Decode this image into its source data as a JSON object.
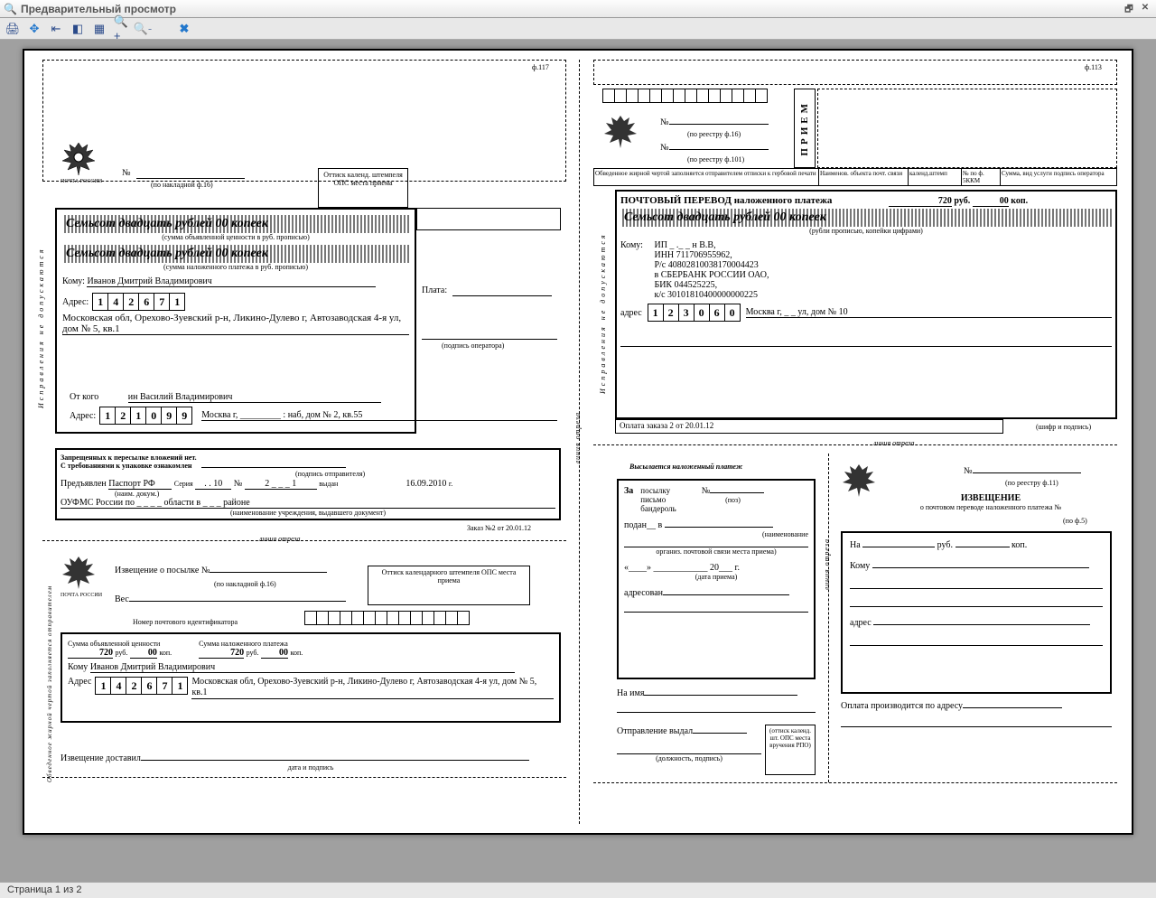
{
  "window": {
    "title": "Предварительный просмотр"
  },
  "status": {
    "page": "Страница 1 из 2"
  },
  "formNums": {
    "f117": "ф.117",
    "f113": "ф.113",
    "f101": "(по реестру ф.101)",
    "f16": "(по реестру ф.16)",
    "f16b": "(по накладной ф.16)",
    "f11": "(по реестру ф.11)",
    "f5": "(по ф.5)"
  },
  "nakl": {
    "no": "№",
    "sum_text": "Семьсот двадцать рублей 00 копеек",
    "sum_caption1": "(сумма объявленной ценности в руб. прописью)",
    "sum_caption2": "(сумма наложенного платежа в руб. прописью)",
    "komu": "Кому:",
    "komu_val": "Иванов Дмитрий Владимирович",
    "plata": "Плата:",
    "adres": "Адрес:",
    "idx": [
      "1",
      "4",
      "2",
      "6",
      "7",
      "1"
    ],
    "adres_val": "Московская обл, Орехово-Зуевский р-н, Ликино-Дулево г, Автозаводская 4-я ул, дом № 5, кв.1",
    "oper_sign": "(подпись оператора)",
    "otkogo": "От кого",
    "otkogo_val": "ин Василий Владимирович",
    "idx2": [
      "1",
      "2",
      "1",
      "0",
      "9",
      "9"
    ],
    "adres2_val": "Москва г, _________ : наб, дом № 2, кв.55",
    "zapret": "Запрещенных к пересылке вложений нет.",
    "treb": "С требованиями к упаковке ознакомлен",
    "otpr_sign": "(подпись отправителя)",
    "pred": "Предъявлен",
    "doc": "Паспорт РФ",
    "ser": "Серия",
    "ser_v": ". . 10",
    "no2": "№",
    "no2_v": "2 _ _ _ 1",
    "vydan": "выдан",
    "date": "16.09.2010",
    "g": "г.",
    "oufms": "ОУФМС России по _ _ _       _ области в _ _          _ районе",
    "doc_cap": "(наименование учреждения, выдавшего документ)",
    "doc_cap2": "(наим. докум.)",
    "stamp": "Оттиск календ. штемпеля ОПС места приема",
    "order": "Заказ №2 от 20.01.12",
    "ispravleniya": "Исправления    не    допускаются",
    "cut": "линия отреза"
  },
  "f113r": {
    "pochtovy": "ПОЧТОВЫЙ ПЕРЕВОД наложенного платежа",
    "rub": "720",
    "rubL": "руб.",
    "kop": "00",
    "kopL": "коп.",
    "sum_text": "Семьсот двадцать рублей 00 копеек",
    "sum_cap": "(рубли прописью, копейки цифрами)",
    "komu": "Кому:",
    "ip": "ИП _ ._       _ н В.В,",
    "inn": "ИНН 711706955962,",
    "rs": "Р/с 40802810038170004423",
    "bank": "в СБЕРБАНК РОССИИ ОАО,",
    "bik": "БИК 044525225,",
    "ks": "к/с 30101810400000000225",
    "adres": "адрес",
    "idx": [
      "1",
      "2",
      "3",
      "0",
      "6",
      "0"
    ],
    "adres_val": "Москва г, _          _ ул, дом № 10",
    "oplata": "Оплата заказа 2 от 20.01.12",
    "shifr": "(шифр и подпись)",
    "cols": {
      "obved": "Обведенное жирной чертой заполняется отправителем отписки к гербовой печати",
      "naimen": "Наименов. объекта почт. связи",
      "kalend": "календ.штемп",
      "netof": "№ по ф. 5ККМ",
      "summa": "Сумма, вид услуги подпись оператора"
    },
    "priem": "ПРИЕМ"
  },
  "izv": {
    "notice": "Извещение о посылке №",
    "ves": "Вес",
    "potid": "Номер почтового идентификатора",
    "stamp": "Оттиск календарного штемпеля ОПС места приема",
    "sum_ob": "Сумма объявленной ценности",
    "sum_np": "Сумма наложенного платежа",
    "rub": "720",
    "rubL": "руб.",
    "kop": "00",
    "kopL": "коп.",
    "komu": "Кому",
    "komu_val": "Иванов Дмитрий Владимирович",
    "adres": "Адрес",
    "idx": [
      "1",
      "4",
      "2",
      "6",
      "7",
      "1"
    ],
    "adres_val": "Московская обл, Орехово-Зуевский р-н, Ликино-Дулево г, Автозаводская 4-я ул, дом № 5, кв.1",
    "dost": "Извещение доставил",
    "dp": "дата и подпись",
    "obved_vert": "Обведенное жирной чертой заполняется отправителем"
  },
  "vysk": {
    "title": "Высылается наложенный платеж",
    "za": "За",
    "posylka": "посылку",
    "pismo": "письмо",
    "band": "бандероль",
    "no": "№",
    "poz": "(поз)",
    "podan": "подан__",
    "v": "в",
    "naimen": "(наименование",
    "org": "организ. почтовой связи места приема)",
    "date_q": "«____» ____________ 20___ г.",
    "date_cap": "(дата приема)",
    "adresovan": "адресован",
    "naimya": "На имя",
    "otprvydal": "Отправление выдал",
    "dolzhn": "(должность, подпись)",
    "stamp": "(оттиск календ. шт. ОПС места вручения РПО)",
    "cut_v": "линия отреза"
  },
  "izv2": {
    "title": "ИЗВЕЩЕНИЕ",
    "sub": "о почтовом переводе наложенного платежа №",
    "na": "На",
    "rubL": "руб.",
    "kopL": "коп.",
    "komu": "Кому",
    "adres": "адрес",
    "oplata": "Оплата производится по адресу"
  }
}
